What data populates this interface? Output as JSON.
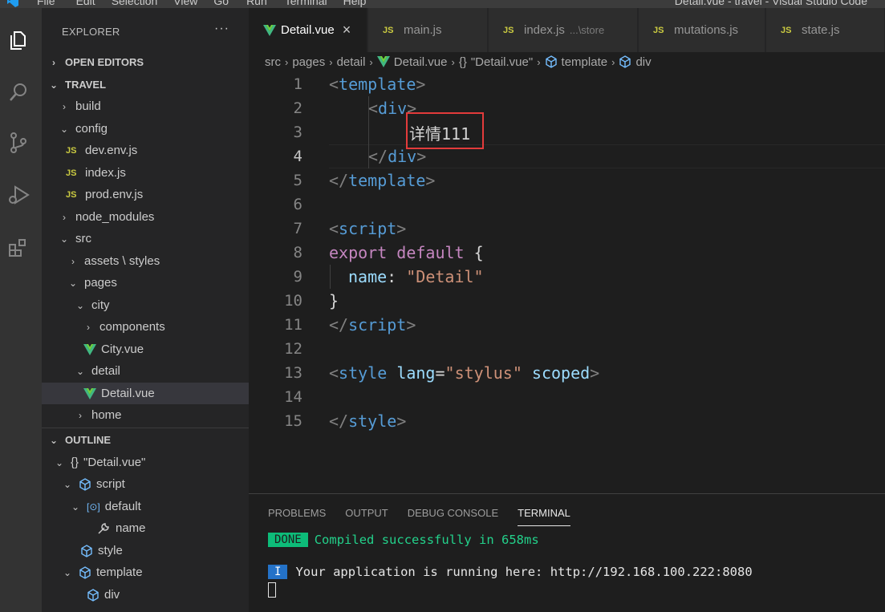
{
  "window": {
    "title": "Detail.vue - travel - Visual Studio Code",
    "menu": [
      "File",
      "Edit",
      "Selection",
      "View",
      "Go",
      "Run",
      "Terminal",
      "Help"
    ]
  },
  "activity_bar": [
    "files-icon",
    "search-icon",
    "source-control-icon",
    "run-debug-icon",
    "extensions-icon"
  ],
  "sidebar": {
    "header": "EXPLORER",
    "more": "···",
    "open_editors": "OPEN EDITORS",
    "project": "TRAVEL",
    "tree": [
      {
        "label": "build",
        "kind": "folder",
        "open": false
      },
      {
        "label": "config",
        "kind": "folder",
        "open": true
      },
      {
        "label": "dev.env.js",
        "kind": "js"
      },
      {
        "label": "index.js",
        "kind": "js"
      },
      {
        "label": "prod.env.js",
        "kind": "js"
      },
      {
        "label": "node_modules",
        "kind": "folder",
        "open": false
      },
      {
        "label": "src",
        "kind": "folder",
        "open": true
      },
      {
        "label": "assets \\ styles",
        "kind": "folder",
        "open": false
      },
      {
        "label": "pages",
        "kind": "folder",
        "open": true
      },
      {
        "label": "city",
        "kind": "folder",
        "open": true
      },
      {
        "label": "components",
        "kind": "folder",
        "open": false
      },
      {
        "label": "City.vue",
        "kind": "vue"
      },
      {
        "label": "detail",
        "kind": "folder",
        "open": true
      },
      {
        "label": "Detail.vue",
        "kind": "vue",
        "selected": true
      },
      {
        "label": "home",
        "kind": "folder",
        "open": false
      }
    ],
    "outline": "OUTLINE",
    "outline_items": [
      {
        "label": "\"Detail.vue\"",
        "icon": "{}"
      },
      {
        "label": "script",
        "icon": "cube"
      },
      {
        "label": "default",
        "icon": "module"
      },
      {
        "label": "name",
        "icon": "wrench"
      },
      {
        "label": "style",
        "icon": "cube"
      },
      {
        "label": "template",
        "icon": "cube"
      },
      {
        "label": "div",
        "icon": "cube"
      }
    ]
  },
  "tabs": [
    {
      "label": "Detail.vue",
      "icon": "vue",
      "active": true,
      "close": "×"
    },
    {
      "label": "main.js",
      "icon": "JS"
    },
    {
      "label": "index.js",
      "icon": "JS",
      "hint": "...\\store"
    },
    {
      "label": "mutations.js",
      "icon": "JS"
    },
    {
      "label": "state.js",
      "icon": "JS"
    }
  ],
  "breadcrumb": [
    "src",
    "pages",
    "detail",
    "Detail.vue",
    "\"Detail.vue\"",
    "template",
    "div"
  ],
  "breadcrumb_obj_icon": "{}",
  "editor": {
    "line_numbers": [
      "1",
      "2",
      "3",
      "4",
      "5",
      "6",
      "7",
      "8",
      "9",
      "10",
      "11",
      "12",
      "13",
      "14",
      "15"
    ],
    "l1": {
      "open": "<",
      "tag": "template",
      "close": ">"
    },
    "l2": {
      "open": "<",
      "tag": "div",
      "close": ">"
    },
    "l3": {
      "text": "详情111"
    },
    "l4": {
      "open": "</",
      "tag": "div",
      "close": ">"
    },
    "l5": {
      "open": "</",
      "tag": "template",
      "close": ">"
    },
    "l7": {
      "open": "<",
      "tag": "script",
      "close": ">"
    },
    "l8": {
      "kw1": "export",
      "kw2": "default",
      "brace": "{"
    },
    "l9": {
      "key": "name",
      "colon": ":",
      "value": "\"Detail\""
    },
    "l10": {
      "brace": "}"
    },
    "l11": {
      "open": "</",
      "tag": "script",
      "close": ">"
    },
    "l13": {
      "open": "<",
      "tag": "style",
      "attr1": "lang",
      "eq": "=",
      "val": "\"stylus\"",
      "attr2": "scoped",
      "close": ">"
    },
    "l15": {
      "open": "</",
      "tag": "style",
      "close": ">"
    }
  },
  "panel": {
    "tabs": [
      "PROBLEMS",
      "OUTPUT",
      "DEBUG CONSOLE",
      "TERMINAL"
    ],
    "active_tab": "TERMINAL",
    "line1": {
      "badge": "DONE",
      "text": "Compiled successfully in 658ms"
    },
    "line2": {
      "badge": "I",
      "text": "Your application is running here: http://192.168.100.222:8080"
    }
  },
  "colors": {
    "accent": "#007acc",
    "highlight_box": "#e33b3b",
    "done": "#0dbc79"
  }
}
